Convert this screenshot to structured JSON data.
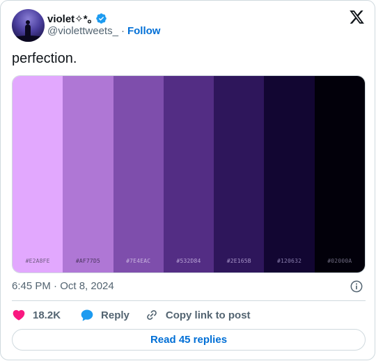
{
  "author": {
    "display_name": "violet✧*｡",
    "handle": "@violettweets_",
    "separator": "·",
    "follow_label": "Follow",
    "verified": true
  },
  "tweet": {
    "text": "perfection.",
    "timestamp": "6:45 PM · Oct 8, 2024"
  },
  "palette": [
    {
      "hex_label": "#E2A8FE",
      "color": "#E2A8FE",
      "label_color": "#6f5a80"
    },
    {
      "hex_label": "#AF77D5",
      "color": "#AF77D5",
      "label_color": "#4b3560"
    },
    {
      "hex_label": "#7E4EAC",
      "color": "#7E4EAC",
      "label_color": "#c9b4e0"
    },
    {
      "hex_label": "#532D84",
      "color": "#532D84",
      "label_color": "#b9a4d6"
    },
    {
      "hex_label": "#2E165B",
      "color": "#2E165B",
      "label_color": "#a795c8"
    },
    {
      "hex_label": "#120632",
      "color": "#120632",
      "label_color": "#8a7fae"
    },
    {
      "hex_label": "#02000A",
      "color": "#02000A",
      "label_color": "#6e6a80"
    }
  ],
  "actions": {
    "like_count": "18.2K",
    "reply_label": "Reply",
    "copy_label": "Copy link to post"
  },
  "read_replies_label": "Read 45 replies",
  "colors": {
    "accent": "#006fd6",
    "like": "#f91880",
    "verified": "#1d9bf0"
  },
  "icons": [
    "verified-badge-icon",
    "x-logo-icon",
    "info-icon",
    "heart-icon",
    "reply-bubble-icon",
    "link-icon"
  ]
}
